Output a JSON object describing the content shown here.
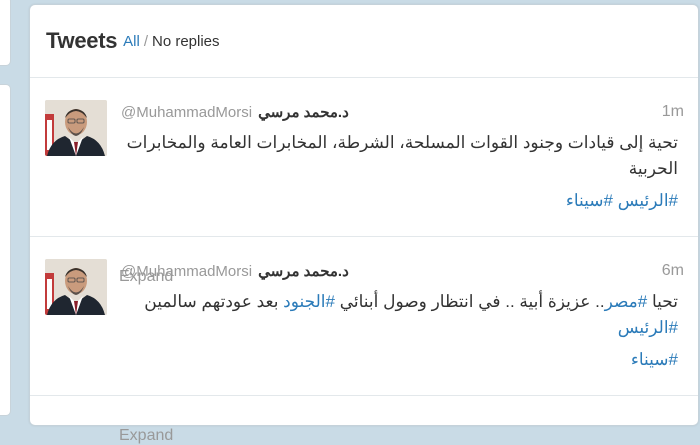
{
  "header": {
    "title": "Tweets",
    "filter_all": "All",
    "separator": "/",
    "filter_no_replies": "No replies"
  },
  "colors": {
    "link": "#2b7bb9",
    "muted": "#999999",
    "text": "#333333",
    "background": "#c9dbe6"
  },
  "tweets": [
    {
      "full_name": "د.محمد مرسي",
      "screen_name": "@MuhammadMorsi",
      "time": "1m",
      "text_line1": "تحية إلى قيادات وجنود القوات المسلحة، الشرطة، المخابرات العامة والمخابرات الحربية",
      "hashtag1": "#الرئيس",
      "hashtag2": "#سيناء",
      "expand": "Expand"
    },
    {
      "full_name": "د.محمد مرسي",
      "screen_name": "@MuhammadMorsi",
      "time": "6m",
      "text_part1": "تحيا ",
      "hashtag_egypt": "#مصر",
      "text_part2": ".. عزيزة أبية .. في انتظار وصول أبنائي ",
      "hashtag_soldiers": "#الجنود",
      "text_part3": " بعد عودتهم سالمين ",
      "hashtag_president": "#الرئيس",
      "hashtag_sinai": "#سيناء",
      "expand": "Expand"
    }
  ]
}
